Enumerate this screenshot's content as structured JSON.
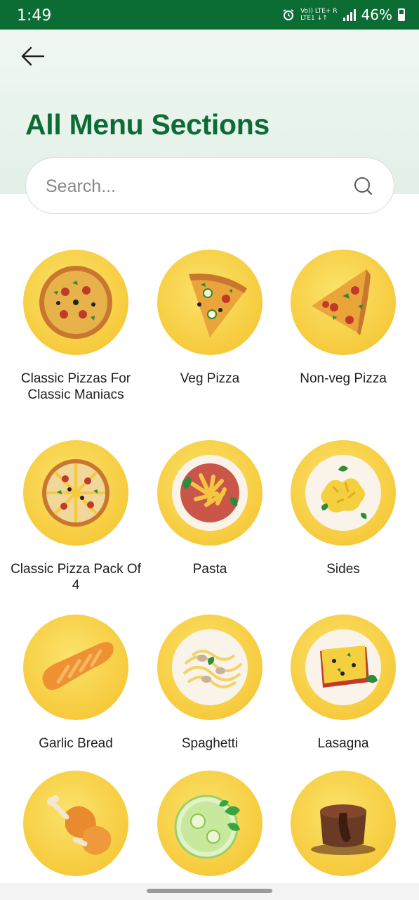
{
  "status_bar": {
    "time": "1:49",
    "network_line1": "Vo)) LTE+ R",
    "network_line2": "LTE1 ↓↑",
    "battery": "46%"
  },
  "header": {
    "title": "All Menu Sections"
  },
  "search": {
    "placeholder": "Search..."
  },
  "menu_sections": [
    {
      "label": "Classic Pizzas For Classic Maniacs",
      "icon": "whole-pizza-icon"
    },
    {
      "label": "Veg Pizza",
      "icon": "veg-pizza-slice-icon"
    },
    {
      "label": "Non-veg Pizza",
      "icon": "nonveg-pizza-slice-icon"
    },
    {
      "label": "Classic Pizza Pack Of 4",
      "icon": "pizza-pack-icon"
    },
    {
      "label": "Pasta",
      "icon": "pasta-plate-icon"
    },
    {
      "label": "Sides",
      "icon": "sides-plate-icon"
    },
    {
      "label": "Garlic Bread",
      "icon": "garlic-bread-icon"
    },
    {
      "label": "Spaghetti",
      "icon": "spaghetti-plate-icon"
    },
    {
      "label": "Lasagna",
      "icon": "lasagna-plate-icon"
    },
    {
      "label": "",
      "icon": "chicken-drumstick-icon"
    },
    {
      "label": "",
      "icon": "mojito-glass-icon"
    },
    {
      "label": "",
      "icon": "chocolate-lava-cake-icon"
    }
  ],
  "colors": {
    "status_bar": "#0b6c34",
    "title": "#0d6b35",
    "tile_circle": "#f6c93a"
  }
}
